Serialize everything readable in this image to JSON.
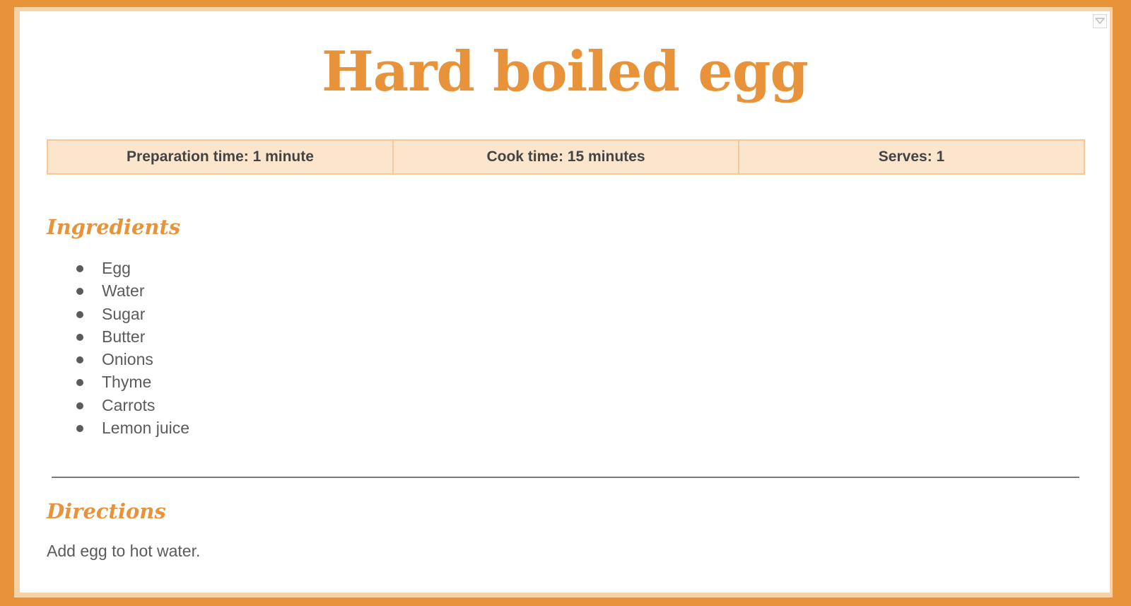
{
  "recipe": {
    "title": "Hard boiled egg",
    "info": {
      "prep_time": "Preparation time: 1 minute",
      "cook_time": "Cook time: 15 minutes",
      "serves": "Serves: 1"
    },
    "ingredients_heading": "Ingredients",
    "ingredients": [
      "Egg",
      "Water",
      "Sugar",
      "Butter",
      "Onions",
      "Thyme",
      "Carrots",
      "Lemon juice"
    ],
    "directions_heading": "Directions",
    "directions": "Add egg to hot water."
  },
  "controls": {
    "corner_menu_icon": "chevron-down-icon"
  },
  "colors": {
    "accent": "#e8923a",
    "frame_inner": "#f6d2a6",
    "info_bar_bg": "#fce5cd",
    "info_bar_border": "#f6c797",
    "body_text": "#5b5b5b",
    "bold_text": "#444444"
  }
}
